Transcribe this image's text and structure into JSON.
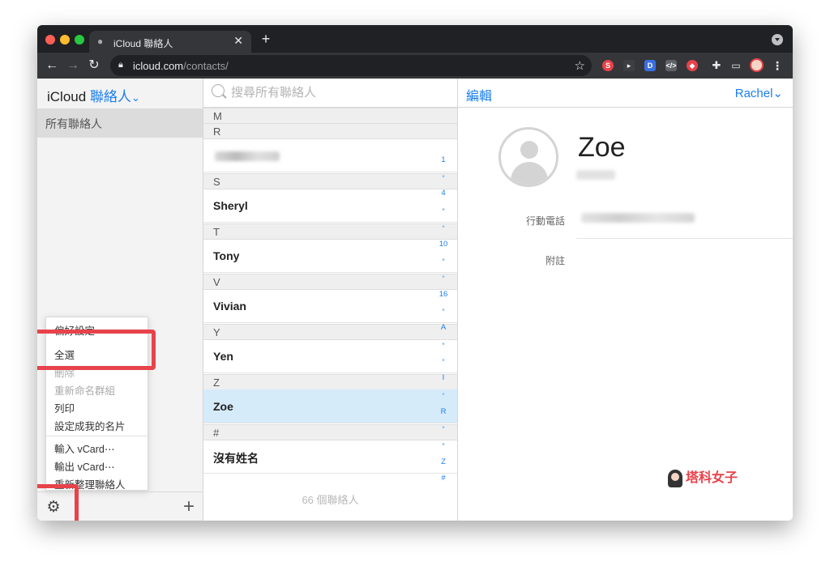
{
  "browser": {
    "tab_title": "iCloud 聯絡人",
    "tab_close": "✕",
    "new_tab": "+",
    "url_host": "icloud.com",
    "url_path": "/contacts/",
    "nav_back": "←",
    "nav_forward": "→",
    "nav_reload": "↻",
    "extensions": [
      {
        "name": "s-extension",
        "label": "S",
        "color": "#e8424a"
      },
      {
        "name": "cursor-extension",
        "label": "▸",
        "color": "#3c4043"
      },
      {
        "name": "d-extension",
        "label": "D",
        "color": "#3b6fe0"
      },
      {
        "name": "code-extension",
        "label": "</>",
        "color": "#5f6368"
      },
      {
        "name": "shield-extension",
        "label": "◆",
        "color": "#e8424a"
      }
    ]
  },
  "sidebar": {
    "title_prefix": "iCloud",
    "title_app": "聯絡人",
    "title_chevron": "⌄",
    "group_all": "所有聯絡人",
    "gear": "⚙",
    "add": "+"
  },
  "menu": {
    "items": [
      "偏好設定⋯",
      "全選",
      "刪除",
      "重新命名群組",
      "列印",
      "設定成我的名片",
      "輸入 vCard⋯",
      "輸出 vCard⋯",
      "重新整理聯絡人"
    ]
  },
  "contacts": {
    "search_placeholder": "搜尋所有聯絡人",
    "sections": [
      {
        "letter": "M",
        "name": ""
      },
      {
        "letter": "R",
        "name": ""
      },
      {
        "letter": "S",
        "name": "Sheryl"
      },
      {
        "letter": "T",
        "name": "Tony"
      },
      {
        "letter": "V",
        "name": "Vivian"
      },
      {
        "letter": "Y",
        "name": "Yen"
      },
      {
        "letter": "Z",
        "name": "Zoe"
      },
      {
        "letter": "#",
        "name": "沒有姓名"
      }
    ],
    "count_label": "66 個聯絡人",
    "index": [
      "1",
      "•",
      "4",
      "•",
      "•",
      "10",
      "•",
      "•",
      "16",
      "•",
      "A",
      "•",
      "•",
      "I",
      "•",
      "R",
      "•",
      "•",
      "Z",
      "#"
    ]
  },
  "detail": {
    "edit_label": "編輯",
    "user_label": "Rachel⌄",
    "name": "Zoe",
    "field_mobile": "行動電話",
    "field_note": "附註"
  },
  "watermark": {
    "text": "塔科女子"
  }
}
